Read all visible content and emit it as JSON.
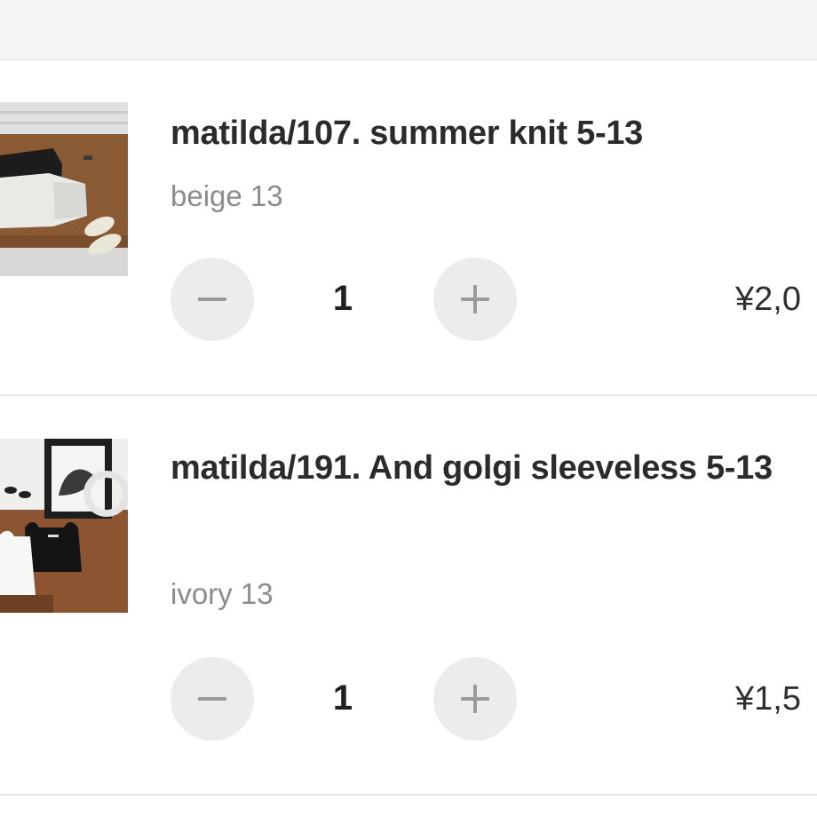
{
  "cart": {
    "items": [
      {
        "title": "matilda/107. summer knit 5-13",
        "variant": "beige 13",
        "quantity": "1",
        "price": "¥2,0"
      },
      {
        "title": "matilda/191. And golgi sleeveless 5-13",
        "variant": "ivory 13",
        "quantity": "1",
        "price": "¥1,5"
      }
    ]
  },
  "colors": {
    "background": "#ffffff",
    "title": "#2b2b2b",
    "variant": "#8c8c8c",
    "button_bg": "#ececec",
    "button_glyph": "#9a9a9a",
    "divider": "#e8e8e8"
  },
  "icons": {
    "decrease": "minus-icon",
    "increase": "plus-icon"
  }
}
